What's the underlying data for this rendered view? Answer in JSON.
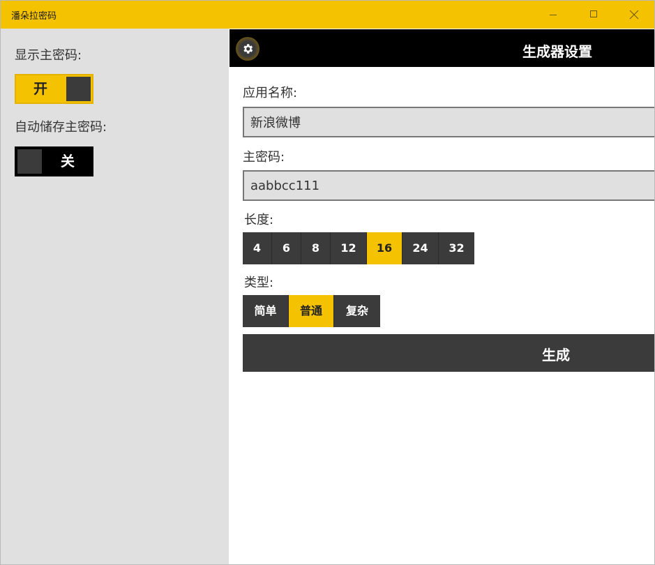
{
  "window": {
    "title": "潘朵拉密码",
    "controls": [
      "minimize-icon",
      "maximize-icon",
      "close-icon"
    ]
  },
  "settings": {
    "show_master_label": "显示主密码:",
    "show_master_toggle": {
      "state": "on",
      "label": "开"
    },
    "autosave_label": "自动储存主密码:",
    "autosave_toggle": {
      "state": "off",
      "label": "关"
    }
  },
  "header": {
    "icon": "gear-icon",
    "title": "生成器设置"
  },
  "form": {
    "app_name_label": "应用名称:",
    "app_name_value": "新浪微博",
    "master_label": "主密码:",
    "master_value": "aabbcc111",
    "length_label": "长度:",
    "length_options": [
      "4",
      "6",
      "8",
      "12",
      "16",
      "24",
      "32"
    ],
    "length_selected": "16",
    "type_label": "类型:",
    "type_options": [
      "简单",
      "普通",
      "复杂"
    ],
    "type_selected": "普通",
    "generate_label": "生成"
  },
  "colors": {
    "accent": "#f5c200",
    "dark": "#3b3b3b",
    "pane": "#e0e0e0",
    "header": "#000000"
  }
}
